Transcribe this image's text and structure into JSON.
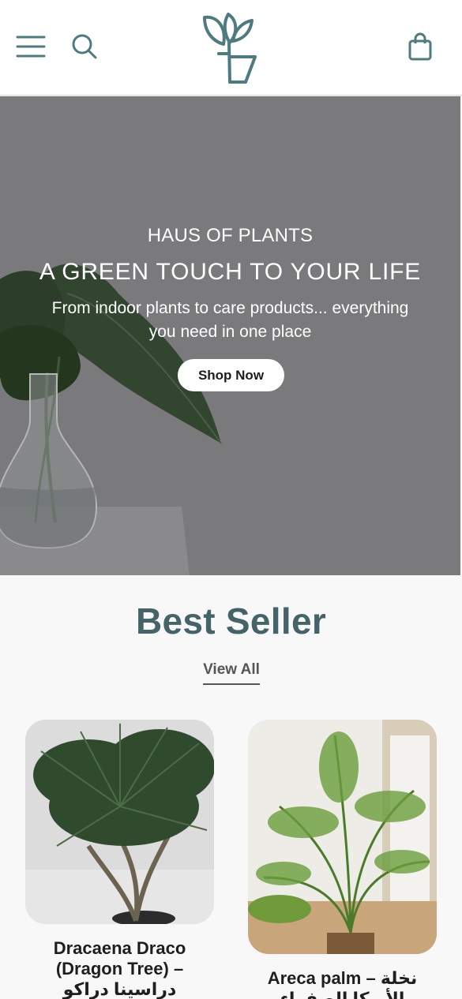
{
  "header": {
    "menu_icon": "hamburger-menu-icon",
    "search_icon": "search-icon",
    "logo_icon": "plant-logo-icon",
    "cart_icon": "shopping-bag-icon",
    "accent_color": "#4e7b80"
  },
  "hero": {
    "eyebrow": "HAUS OF PLANTS",
    "title": "A GREEN TOUCH TO YOUR LIFE",
    "subtitle": "From indoor plants to care products... everything you need in one place",
    "cta_label": "Shop Now",
    "overlay_color": "#7a7a7c"
  },
  "best_seller": {
    "title": "Best Seller",
    "view_all_label": "View All",
    "title_color": "#446469",
    "products": [
      {
        "name": "Dracaena Draco (Dragon Tree) – دراسينا دراكو"
      },
      {
        "name": "Areca palm – نخلة الأريكا الصفراء"
      }
    ]
  }
}
